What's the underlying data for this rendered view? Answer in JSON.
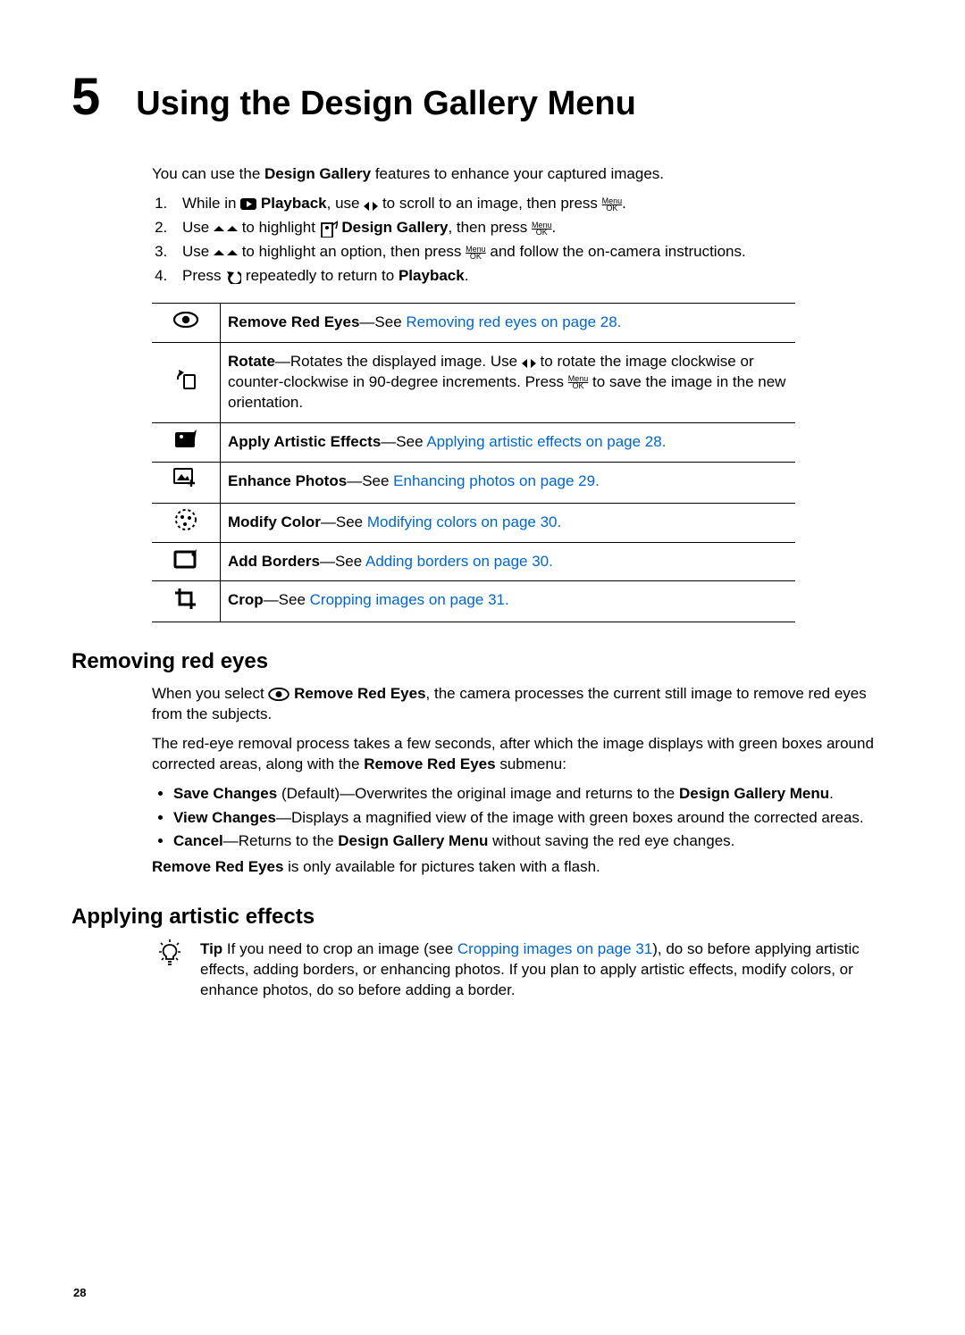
{
  "chapter": {
    "number": "5",
    "title": "Using the Design Gallery Menu"
  },
  "intro": {
    "pre": "You can use the ",
    "bold": "Design Gallery",
    "post": " features to enhance your captured images."
  },
  "steps": {
    "s1a": "While in ",
    "s1b": " Playback",
    "s1c": ", use ",
    "s1d": " to scroll to an image, then press ",
    "s1e": ".",
    "s2a": "Use ",
    "s2b": " to highlight ",
    "s2c": " Design Gallery",
    "s2d": ", then press ",
    "s2e": ".",
    "s3a": "Use ",
    "s3b": " to highlight an option, then press ",
    "s3c": " and follow the on-camera instructions.",
    "s4a": "Press ",
    "s4b": " repeatedly to return to ",
    "s4c": "Playback",
    "s4d": "."
  },
  "table": {
    "r1": {
      "b": "Remove Red Eyes",
      "t": "—See ",
      "link": "Removing red eyes",
      "tail": " on page 28."
    },
    "r2": {
      "b": "Rotate",
      "t1": "—Rotates the displayed image. Use ",
      "t2": " to rotate the image clockwise or counter-clockwise in 90-degree increments. Press ",
      "t3": " to save the image in the new orientation."
    },
    "r3": {
      "b": "Apply Artistic Effects",
      "t": "—See ",
      "link": "Applying artistic effects",
      "tail": " on page 28."
    },
    "r4": {
      "b": "Enhance Photos",
      "t": "—See ",
      "link": "Enhancing photos",
      "tail": " on page 29."
    },
    "r5": {
      "b": "Modify Color",
      "t": "—See ",
      "link": "Modifying colors",
      "tail": " on page 30."
    },
    "r6": {
      "b": "Add Borders",
      "t": "—See ",
      "link": "Adding borders",
      "tail": " on page 30."
    },
    "r7": {
      "b": "Crop",
      "t": "—See ",
      "link": "Cropping images",
      "tail": " on page 31."
    }
  },
  "section_redeye": {
    "heading": "Removing red eyes",
    "p1a": "When you select ",
    "p1b": " Remove Red Eyes",
    "p1c": ", the camera processes the current still image to remove red eyes from the subjects.",
    "p2a": "The red-eye removal process takes a few seconds, after which the image displays with green boxes around corrected areas, along with the ",
    "p2b": "Remove Red Eyes",
    "p2c": " submenu:",
    "b1a": "Save Changes",
    "b1b": " (Default)—Overwrites the original image and returns to the ",
    "b1c": "Design Gallery Menu",
    "b1d": ".",
    "b2a": "View Changes",
    "b2b": "—Displays a magnified view of the image with green boxes around the corrected areas.",
    "b3a": "Cancel",
    "b3b": "—Returns to the ",
    "b3c": "Design Gallery Menu",
    "b3d": " without saving the red eye changes.",
    "p3a": "Remove Red Eyes",
    "p3b": " is only available for pictures taken with a flash."
  },
  "section_artistic": {
    "heading": "Applying artistic effects",
    "tip_label": "Tip",
    "tip1": "  If you need to crop an image (see ",
    "tip_link": "Cropping images",
    "tip_tail": " on page 31",
    "tip2": "), do so before applying artistic effects, adding borders, or enhancing photos. If you plan to apply artistic effects, modify colors, or enhance photos, do so before adding a border."
  },
  "page_number": "28",
  "menu_ok": {
    "top": "Menu",
    "bot": "OK"
  }
}
